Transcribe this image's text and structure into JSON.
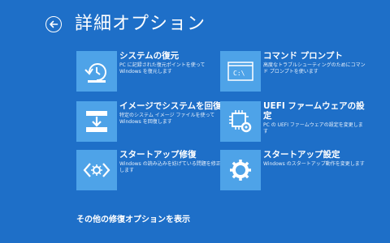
{
  "header": {
    "title": "詳細オプション"
  },
  "tiles": [
    {
      "title": "システムの復元",
      "desc": "PC に記録された復元ポイントを使って Windows を復元します",
      "icon": "system-restore-icon"
    },
    {
      "title": "コマンド プロンプト",
      "desc": "高度なトラブルシューティングのためにコマンド プロンプトを使います",
      "icon": "command-prompt-icon"
    },
    {
      "title": "イメージでシステムを回復",
      "desc": "特定のシステム イメージ ファイルを使って Windows を回復します",
      "icon": "system-image-recovery-icon"
    },
    {
      "title": "UEFI ファームウェアの設定",
      "desc": "PC の UEFI ファームウェアの設定を変更します",
      "icon": "uefi-firmware-icon"
    },
    {
      "title": "スタートアップ修復",
      "desc": "Windows の読み込みを妨げている問題を修正します",
      "icon": "startup-repair-icon"
    },
    {
      "title": "スタートアップ設定",
      "desc": "Windows のスタートアップ動作を変更します",
      "icon": "startup-settings-icon"
    }
  ],
  "footer": {
    "more_link": "その他の修復オプションを表示"
  },
  "colors": {
    "background": "#1e6fc8",
    "tile_icon_bg": "#4ea3e8",
    "text": "#ffffff"
  }
}
